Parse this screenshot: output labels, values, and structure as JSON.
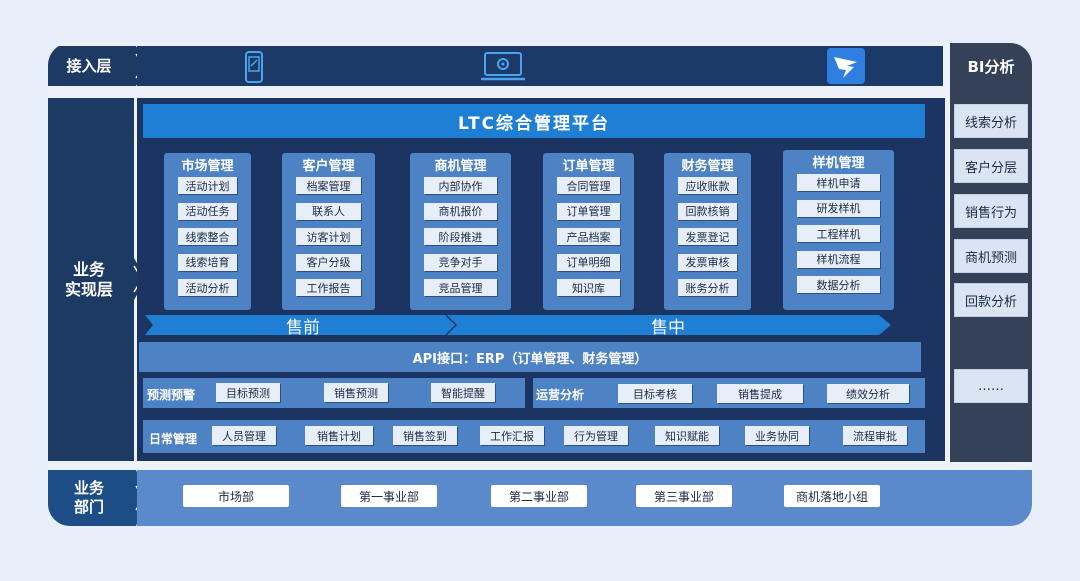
{
  "layers": {
    "access": "接入层",
    "business": "业务\n实现层",
    "dept": "业务\n部门"
  },
  "access_icons": [
    "mobile-phone-icon",
    "laptop-icon",
    "dingtalk-logo-icon"
  ],
  "bi": {
    "title": "BI分析",
    "items": [
      "线索分析",
      "客户分层",
      "销售行为",
      "商机预测",
      "回款分析",
      "……"
    ]
  },
  "platform_title": "LTC综合管理平台",
  "modules": [
    {
      "title": "市场管理",
      "items": [
        "活动计划",
        "活动任务",
        "线索整合",
        "线索培育",
        "活动分析"
      ]
    },
    {
      "title": "客户管理",
      "items": [
        "档案管理",
        "联系人",
        "访客计划",
        "客户分级",
        "工作报告"
      ]
    },
    {
      "title": "商机管理",
      "items": [
        "内部协作",
        "商机报价",
        "阶段推进",
        "竞争对手",
        "竞品管理"
      ]
    },
    {
      "title": "订单管理",
      "items": [
        "合同管理",
        "订单管理",
        "产品档案",
        "订单明细",
        "知识库"
      ]
    },
    {
      "title": "财务管理",
      "items": [
        "应收账款",
        "回款核销",
        "发票登记",
        "发票审核",
        "账务分析"
      ]
    },
    {
      "title": "样机管理",
      "items": [
        "样机申请",
        "研发样机",
        "工程样机",
        "样机流程",
        "数据分析"
      ]
    }
  ],
  "stages": [
    "售前",
    "售中"
  ],
  "api": "API接口：ERP（订单管理、财务管理）",
  "forecast": {
    "title": "预测预警",
    "items": [
      "目标预测",
      "销售预测",
      "智能提醒"
    ]
  },
  "operation": {
    "title": "运营分析",
    "items": [
      "目标考核",
      "销售提成",
      "绩效分析"
    ]
  },
  "daily": {
    "title": "日常管理",
    "items": [
      "人员管理",
      "销售计划",
      "销售签到",
      "工作汇报",
      "行为管理",
      "知识赋能",
      "业务协同",
      "流程审批"
    ]
  },
  "departments": [
    "市场部",
    "第一事业部",
    "第二事业部",
    "第三事业部",
    "商机落地小组"
  ]
}
